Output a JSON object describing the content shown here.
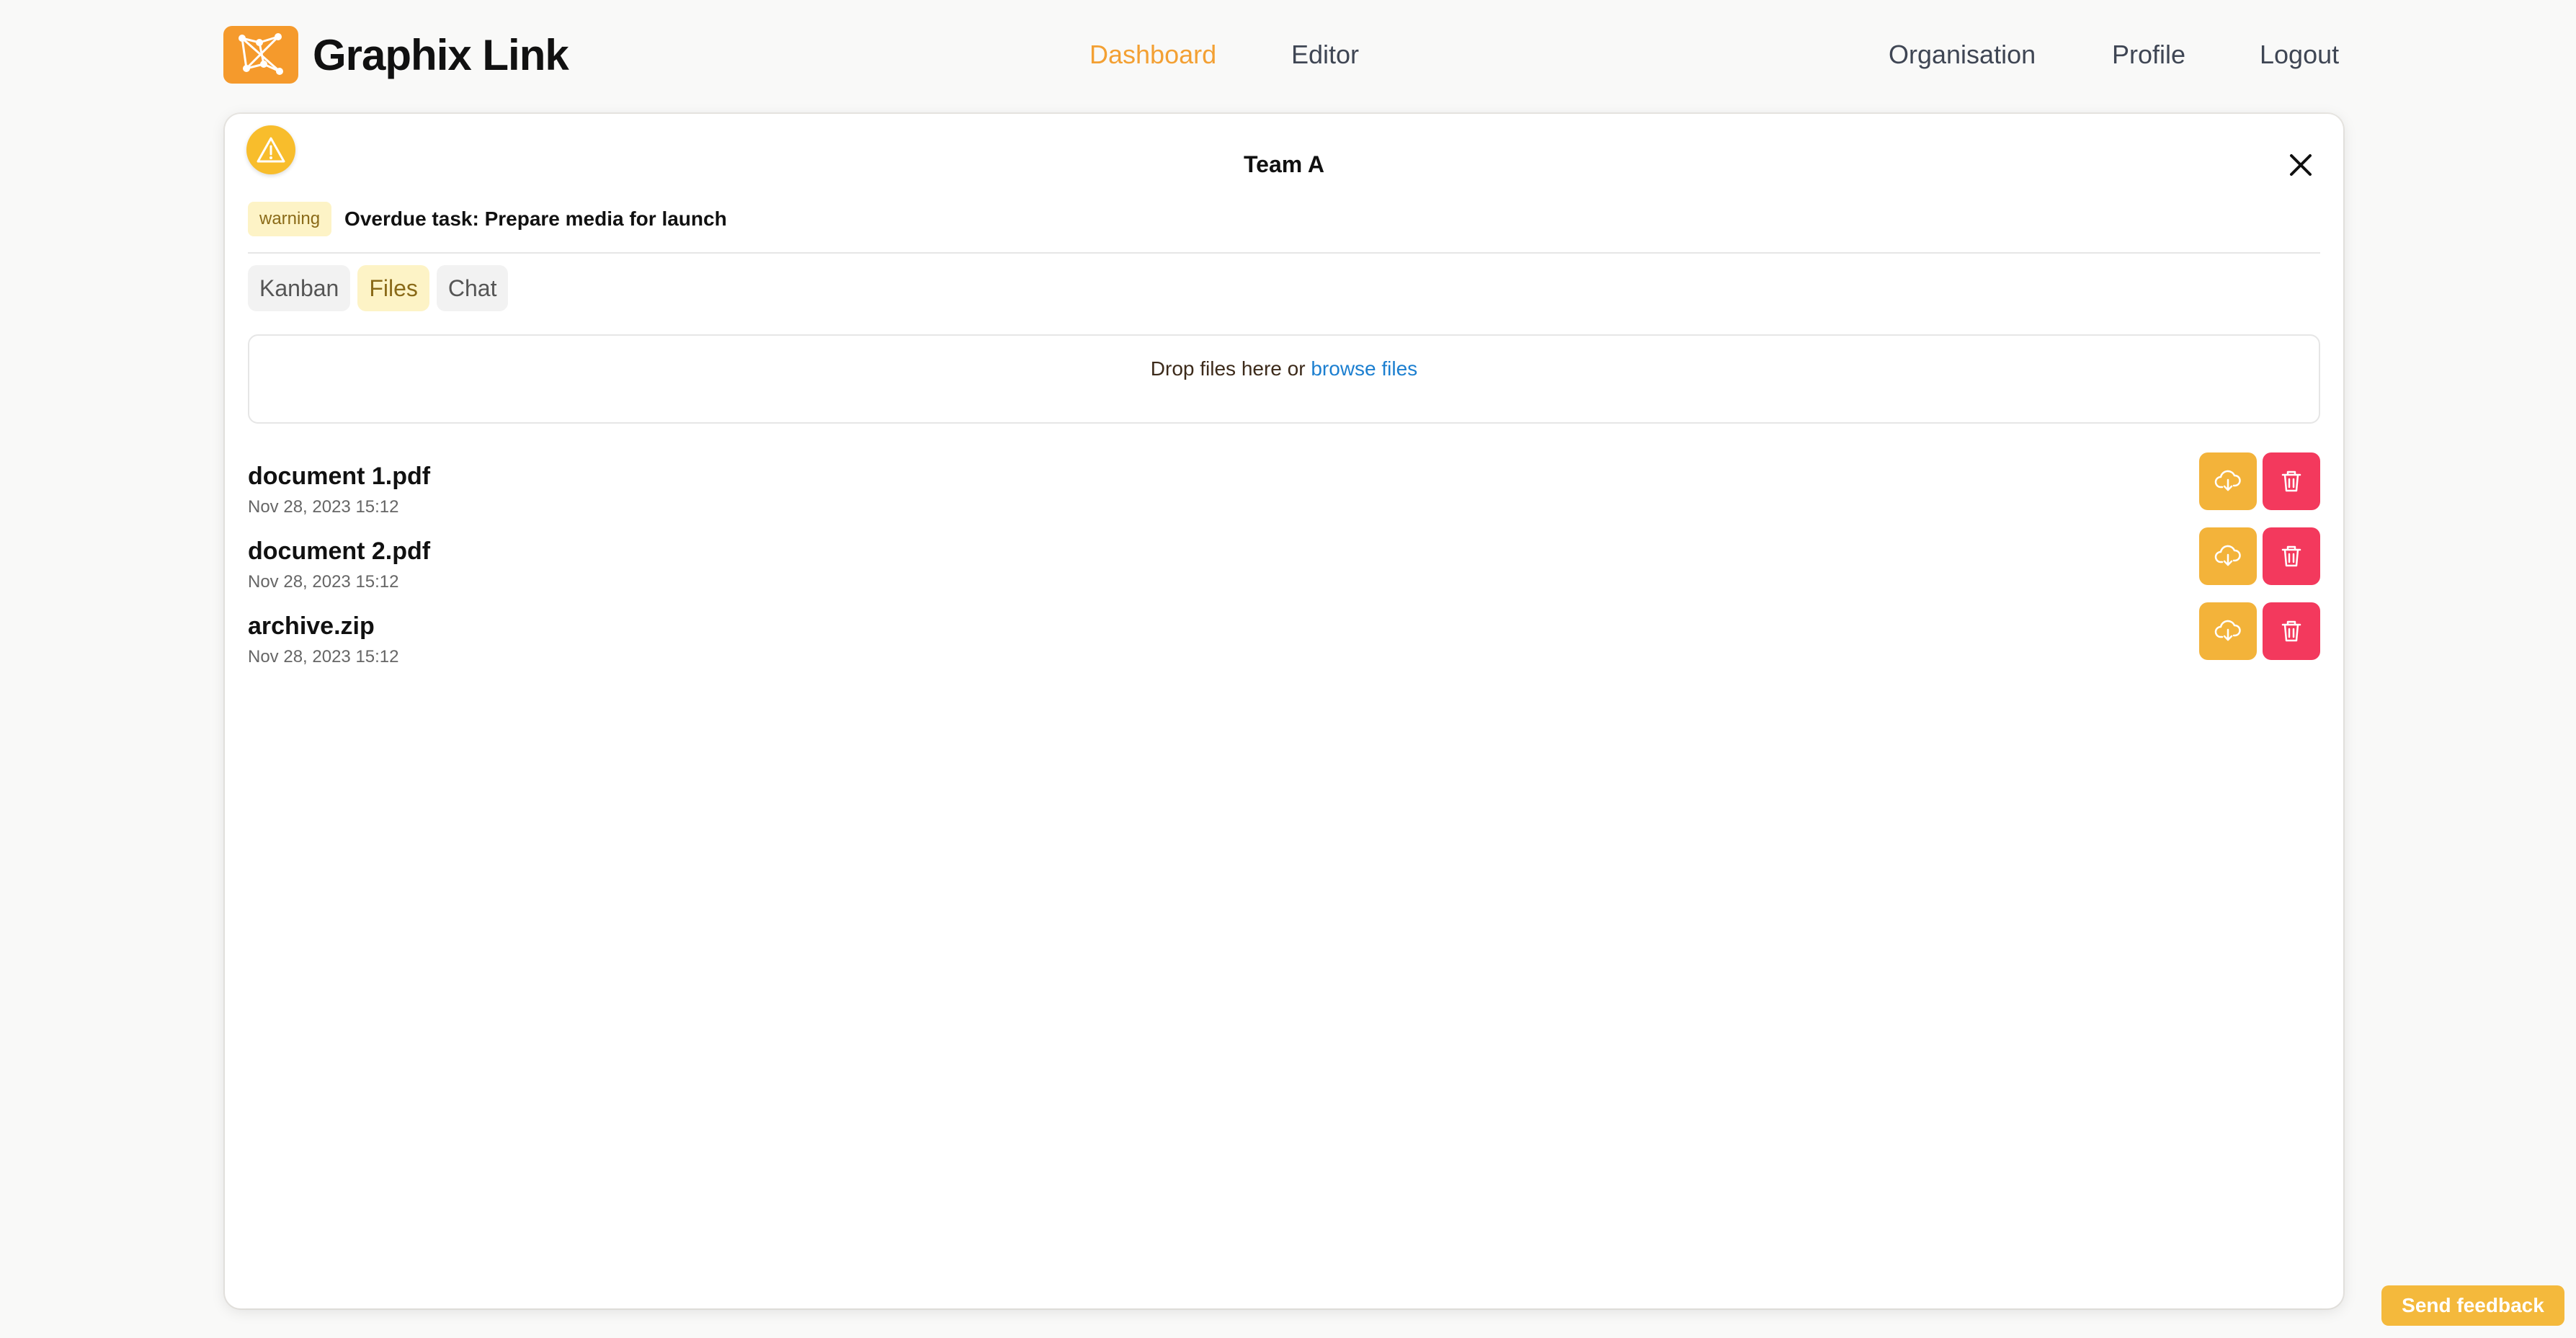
{
  "app": {
    "name": "Graphix Link",
    "logo_icon": "network-graph-icon",
    "brand_color": "#f59a2c"
  },
  "nav": {
    "center": [
      {
        "label": "Dashboard",
        "active": true
      },
      {
        "label": "Editor",
        "active": false
      }
    ],
    "right": [
      {
        "label": "Organisation"
      },
      {
        "label": "Profile"
      },
      {
        "label": "Logout"
      }
    ]
  },
  "panel": {
    "title": "Team A",
    "alert": {
      "badge": "warning",
      "text": "Overdue task: Prepare media for launch",
      "icon": "warning-triangle-icon"
    },
    "tabs": [
      {
        "label": "Kanban",
        "active": false
      },
      {
        "label": "Files",
        "active": true
      },
      {
        "label": "Chat",
        "active": false
      }
    ],
    "dropzone": {
      "text": "Drop files here or",
      "link": "browse files"
    },
    "files": [
      {
        "name": "document 1.pdf",
        "date": "Nov 28, 2023 15:12"
      },
      {
        "name": "document 2.pdf",
        "date": "Nov 28, 2023 15:12"
      },
      {
        "name": "archive.zip",
        "date": "Nov 28, 2023 15:12"
      }
    ]
  },
  "feedback": {
    "label": "Send feedback"
  },
  "colors": {
    "accent": "#f3a033",
    "download": "#f3b33a",
    "delete": "#f3395d",
    "link": "#1c7fd0"
  }
}
